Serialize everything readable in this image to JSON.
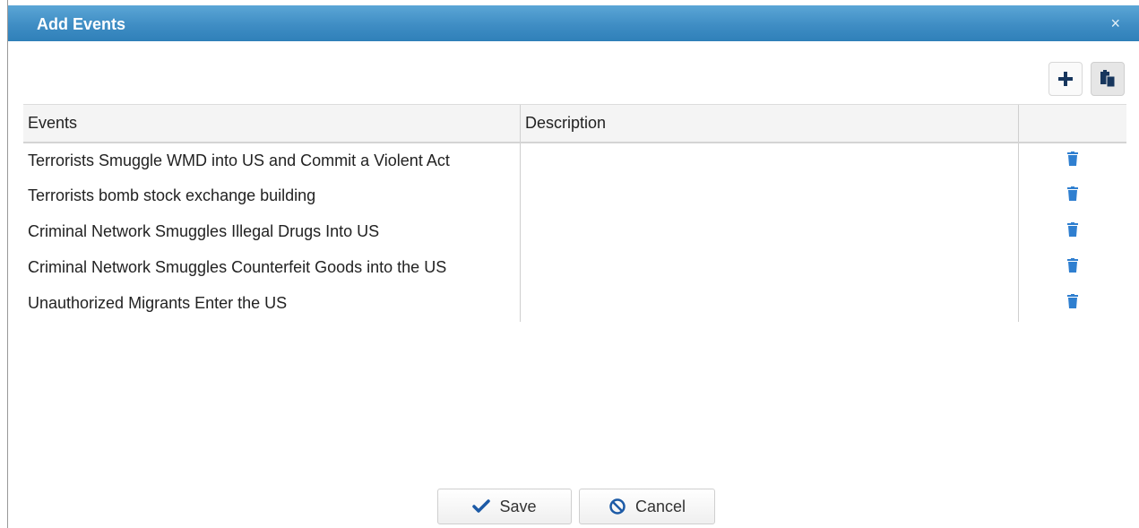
{
  "dialog": {
    "title": "Add Events",
    "close_glyph": "×"
  },
  "toolbar": {
    "add_icon": "plus-icon",
    "paste_icon": "paste-icon"
  },
  "table": {
    "columns": [
      "Events",
      "Description",
      ""
    ],
    "rows": [
      {
        "event": "Terrorists Smuggle WMD into US and Commit a Violent Act",
        "description": ""
      },
      {
        "event": "Terrorists bomb stock exchange building",
        "description": ""
      },
      {
        "event": "Criminal Network Smuggles Illegal Drugs Into US",
        "description": ""
      },
      {
        "event": "Criminal Network Smuggles Counterfeit Goods into the US",
        "description": ""
      },
      {
        "event": "Unauthorized Migrants Enter the US",
        "description": ""
      }
    ],
    "delete_icon": "trash-icon"
  },
  "footer": {
    "save_label": "Save",
    "cancel_label": "Cancel"
  },
  "colors": {
    "header_blue": "#3f8dc4",
    "icon_blue": "#2f7fd0",
    "toolbar_icon": "#17365d"
  }
}
